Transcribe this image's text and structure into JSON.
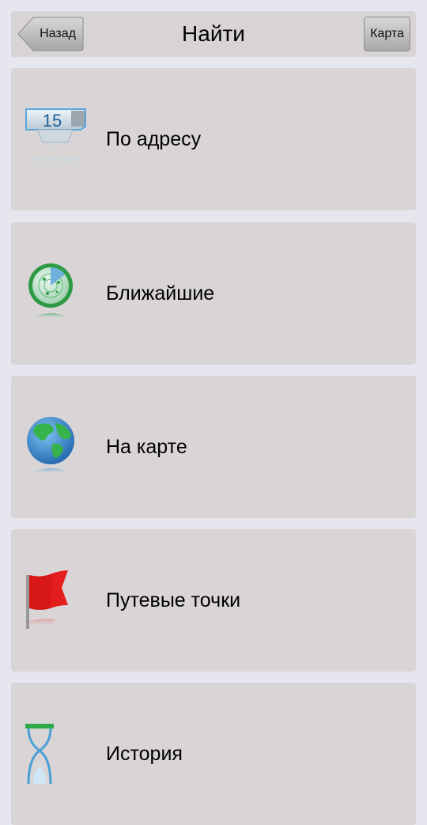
{
  "header": {
    "back_label": "Назад",
    "title": "Найти",
    "map_label": "Карта"
  },
  "menu": [
    {
      "label": "По адресу",
      "icon": "address-sign-icon"
    },
    {
      "label": "Ближайшие",
      "icon": "radar-icon"
    },
    {
      "label": "На карте",
      "icon": "globe-icon"
    },
    {
      "label": "Путевые точки",
      "icon": "flag-icon"
    },
    {
      "label": "История",
      "icon": "hourglass-icon"
    }
  ],
  "address_icon_number": "15"
}
